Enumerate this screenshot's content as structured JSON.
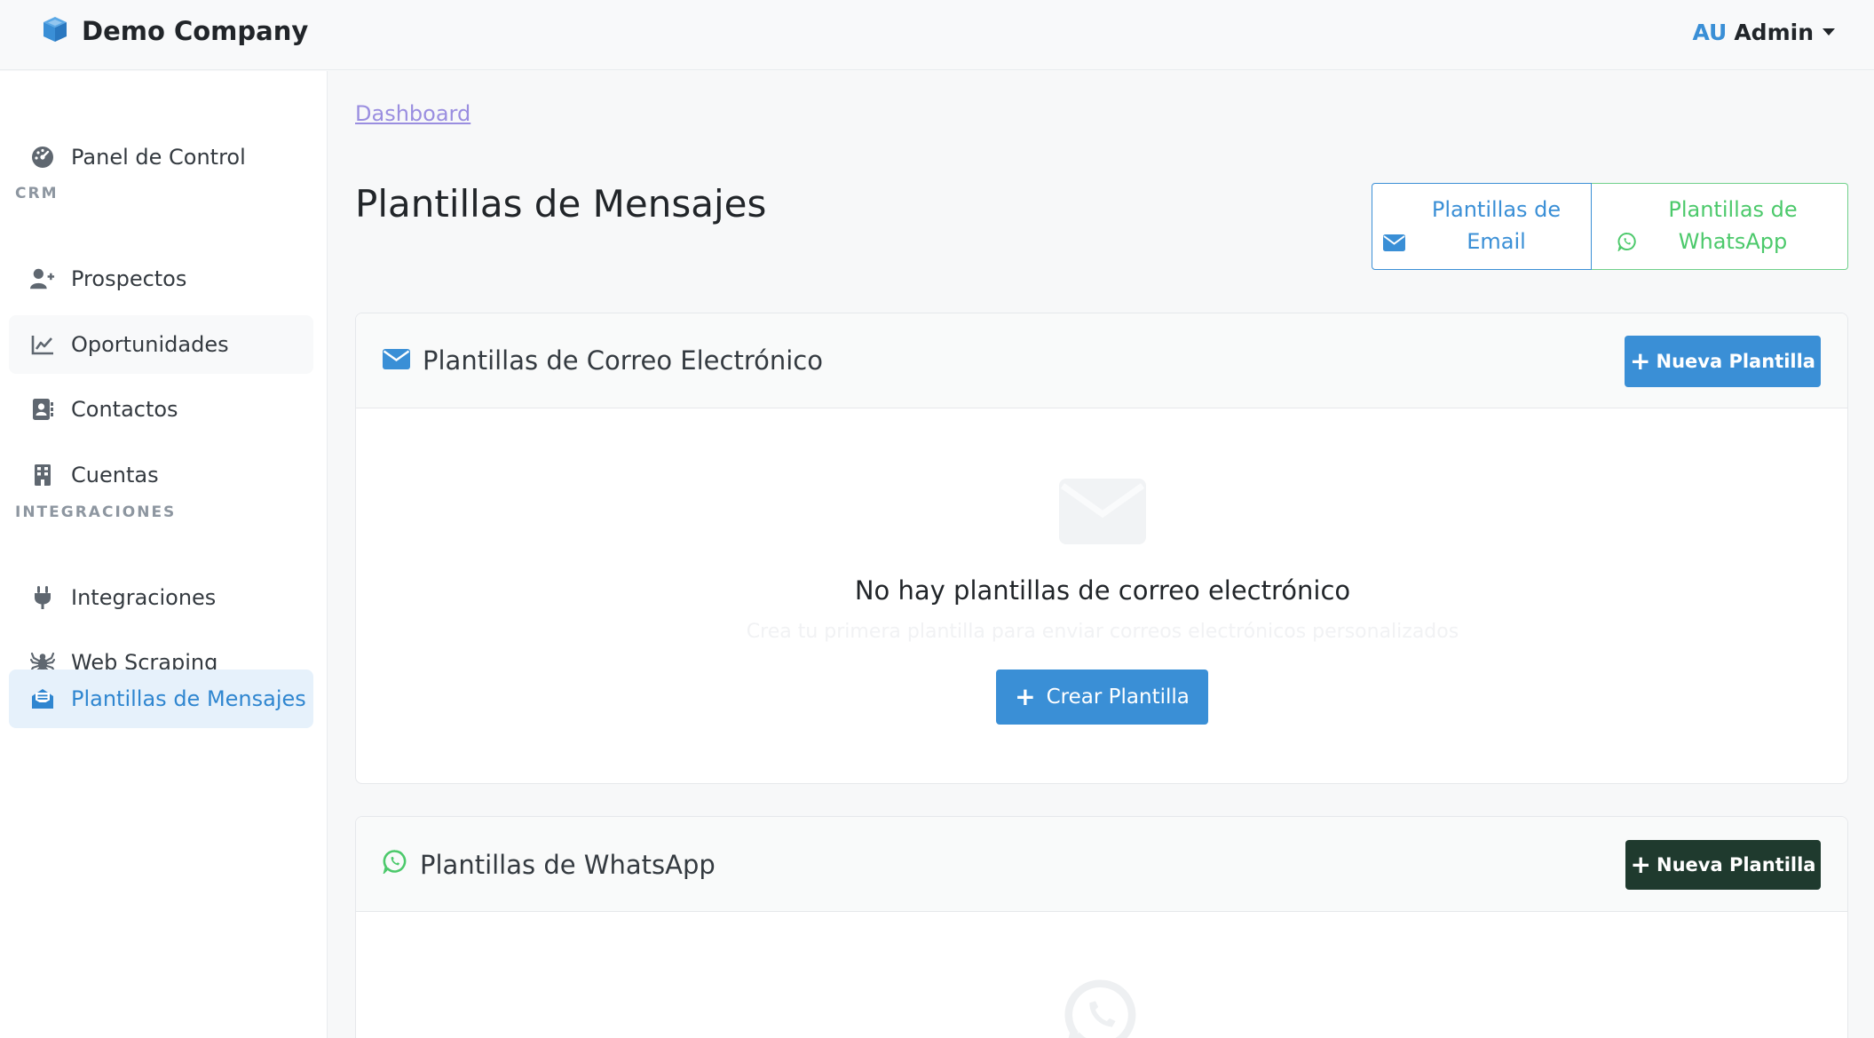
{
  "brand": {
    "name": "Demo Company",
    "icon": "cube-icon"
  },
  "user": {
    "initials": "AU",
    "name": "Admin"
  },
  "sidebar": {
    "items": [
      {
        "label": "Panel de Control",
        "icon": "dashboard-gauge-icon"
      },
      {
        "label": "Prospectos",
        "icon": "user-plus-icon"
      },
      {
        "label": "Oportunidades",
        "icon": "line-chart-icon"
      },
      {
        "label": "Contactos",
        "icon": "address-book-icon"
      },
      {
        "label": "Cuentas",
        "icon": "building-icon"
      },
      {
        "label": "Integraciones",
        "icon": "plug-icon"
      },
      {
        "label": "Web Scraping",
        "icon": "spider-icon"
      },
      {
        "label": "Plantillas de Mensajes",
        "icon": "envelope-open-text-icon"
      }
    ],
    "sections": {
      "crm": "CRM",
      "integrations": "INTEGRACIONES"
    },
    "active_item": "Plantillas de Mensajes"
  },
  "breadcrumb": {
    "link": "Dashboard"
  },
  "page": {
    "title": "Plantillas de Mensajes"
  },
  "toggles": {
    "email": "Plantillas de Email",
    "whatsapp": "Plantillas de WhatsApp"
  },
  "email_card": {
    "title": "Plantillas de Correo Electrónico",
    "new_button": "Nueva Plantilla",
    "empty_title": "No hay plantillas de correo electrónico",
    "empty_subtitle": "Crea tu primera plantilla para enviar correos electrónicos personalizados",
    "create_button": "Crear Plantilla"
  },
  "whatsapp_card": {
    "title": "Plantillas de WhatsApp",
    "new_button": "Nueva Plantilla"
  },
  "colors": {
    "primary": "#3a8fd6",
    "whatsapp": "#4cc96b",
    "dark_button": "#1f3a2e",
    "active_nav_bg": "#e6f1fb"
  }
}
